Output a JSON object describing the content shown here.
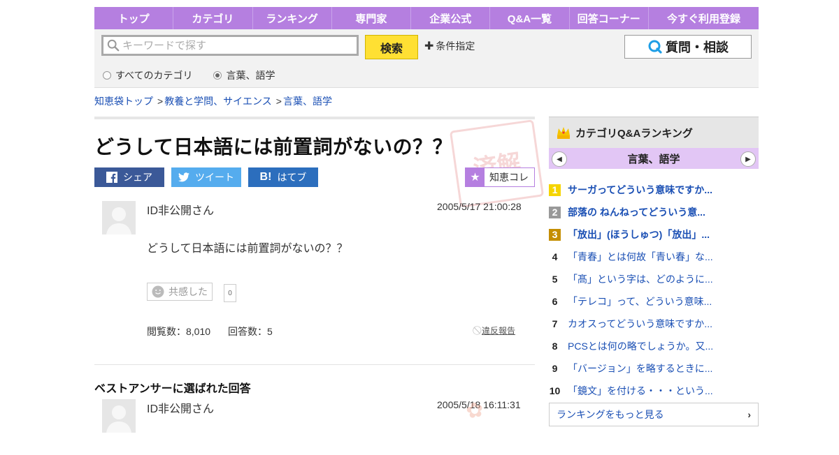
{
  "nav": {
    "items": [
      "トップ",
      "カテゴリ",
      "ランキング",
      "専門家",
      "企業公式",
      "Q&A一覧",
      "回答コーナー",
      "今すぐ利用登録"
    ]
  },
  "search": {
    "placeholder": "キーワードで探す",
    "button_label": "検索",
    "condition_label": "条件指定",
    "ask_label": "質問・相談",
    "radio_all": "すべてのカテゴリ",
    "radio_current": "言葉、語学"
  },
  "breadcrumb": {
    "items": [
      "知恵袋トップ",
      "教養と学問、サイエンス",
      "言葉、語学"
    ]
  },
  "question": {
    "title": "どうして日本語には前置詞がないの？？",
    "share_fb": "シェア",
    "share_tw": "ツイート",
    "share_hb": "はてブ",
    "chie_colle": "知恵コレ",
    "user": "ID非公開さん",
    "date": "2005/5/17  21:00:28",
    "body": "どうして日本語には前置詞がないの？？",
    "empathy_label": "共感した",
    "empathy_count": "0",
    "views": "閲覧数：8,010",
    "answers": "回答数：5",
    "report": "違反報告"
  },
  "best_answer": {
    "heading": "ベストアンサーに選ばれた回答",
    "user": "ID非公開さん",
    "date": "2005/5/18  16:11:31"
  },
  "ranking": {
    "title": "カテゴリQ&Aランキング",
    "category": "言葉、語学",
    "items": [
      {
        "rank": "1",
        "text": "サーガってどういう意味ですか..."
      },
      {
        "rank": "2",
        "text": "部落の ねんねってどういう意..."
      },
      {
        "rank": "3",
        "text": "「放出」(ほうしゅつ)「放出」..."
      },
      {
        "rank": "4",
        "text": "「青春」とは何故「青い春」な..."
      },
      {
        "rank": "5",
        "text": "「髙」という字は、どのように..."
      },
      {
        "rank": "6",
        "text": "「テレコ」って、どういう意味..."
      },
      {
        "rank": "7",
        "text": "カオスってどういう意味ですか..."
      },
      {
        "rank": "8",
        "text": "PCSとは何の略でしょうか。又..."
      },
      {
        "rank": "9",
        "text": "「バージョン」を略するときに..."
      },
      {
        "rank": "10",
        "text": "「鏡文」を付ける・・・という..."
      }
    ],
    "more_label": "ランキングをもっと見る"
  },
  "colors": {
    "nav_purple": "#b57fe0",
    "search_yellow": "#ffe033",
    "link_blue": "#1a4fb4"
  }
}
